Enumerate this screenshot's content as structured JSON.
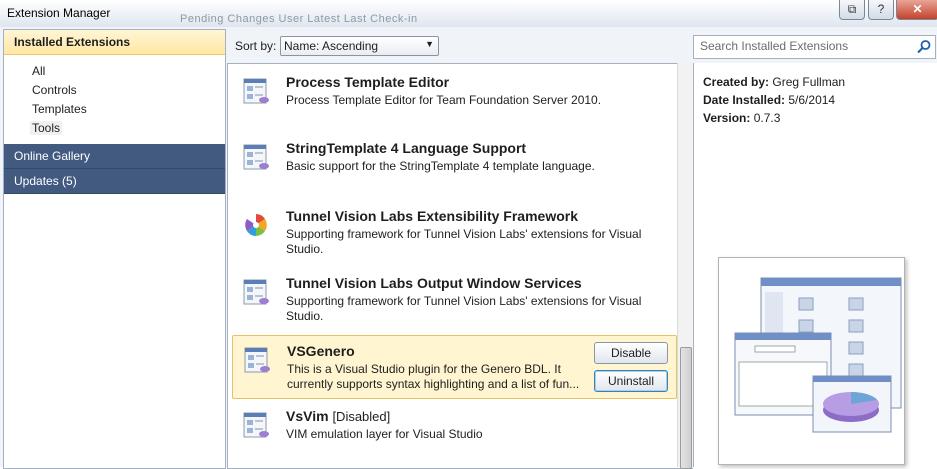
{
  "window": {
    "title": "Extension Manager",
    "background_tabs_text": "Pending Changes   User        Latest    Last Check-in",
    "buttons": {
      "restore": "⧉",
      "help": "?",
      "close": "✕"
    }
  },
  "sidebar": {
    "header": "Installed Extensions",
    "categories": [
      "All",
      "Controls",
      "Templates",
      "Tools"
    ],
    "selected_category": "Tools",
    "sections": [
      "Online Gallery",
      "Updates (5)"
    ],
    "colors": {
      "header_bg": "#ffe7a4",
      "section_bg": "#435a80"
    }
  },
  "toolbar": {
    "sort_label": "Sort by:",
    "sort_value": "Name: Ascending",
    "search_placeholder": "Search Installed Extensions"
  },
  "extensions": [
    {
      "name": "Process Template Editor",
      "status": "",
      "description": "Process Template Editor for Team Foundation Server 2010.",
      "icon": "template-icon",
      "selected": false
    },
    {
      "name": "StringTemplate 4 Language Support",
      "status": "",
      "description": "Basic support for the StringTemplate 4 template language.",
      "icon": "template-icon",
      "selected": false
    },
    {
      "name": "Tunnel Vision Labs Extensibility Framework",
      "status": "",
      "description": "Supporting framework for Tunnel Vision Labs' extensions for Visual Studio.",
      "icon": "pinwheel-icon",
      "selected": false
    },
    {
      "name": "Tunnel Vision Labs Output Window Services",
      "status": "",
      "description": "Supporting framework for Tunnel Vision Labs' extensions for Visual Studio.",
      "icon": "template-icon",
      "selected": false
    },
    {
      "name": "VSGenero",
      "status": "",
      "description": "This is a Visual Studio plugin for the Genero BDL. It currently supports syntax highlighting and a list of fun...",
      "icon": "template-icon",
      "selected": true
    },
    {
      "name": "VsVim",
      "status": "[Disabled]",
      "description": "VIM emulation layer for Visual Studio",
      "icon": "template-icon",
      "selected": false
    }
  ],
  "selected_actions": {
    "disable": "Disable",
    "uninstall": "Uninstall"
  },
  "details": {
    "created_by_label": "Created by:",
    "created_by": "Greg Fullman",
    "date_installed_label": "Date Installed:",
    "date_installed": "5/6/2014",
    "version_label": "Version:",
    "version": "0.7.3",
    "preview_image": "extension-preview-image"
  }
}
